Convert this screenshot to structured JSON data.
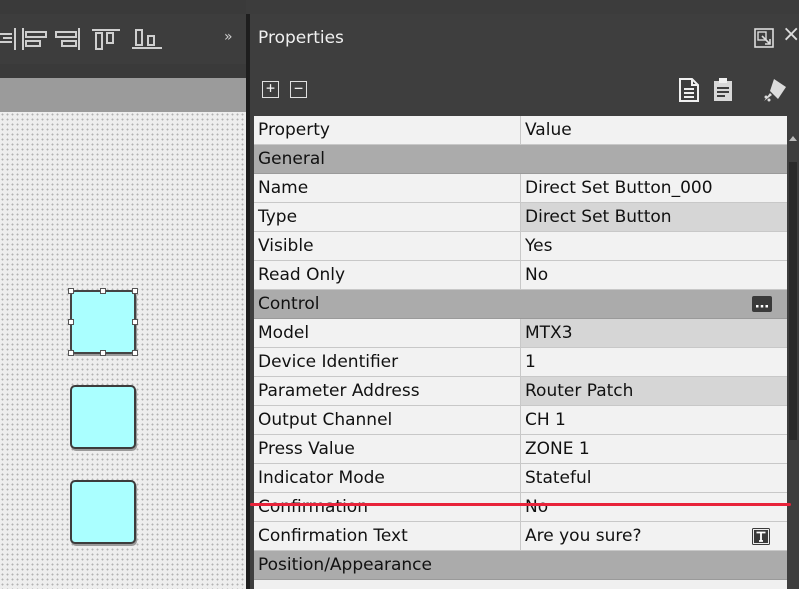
{
  "panel": {
    "title": "Properties",
    "overflow_glyph": "»",
    "close_glyph": "×",
    "expand_glyph": "+",
    "collapse_glyph": "−"
  },
  "grid": {
    "header": {
      "property": "Property",
      "value": "Value"
    },
    "rows": [
      {
        "type": "category",
        "label": "General"
      },
      {
        "type": "prop",
        "key": "Name",
        "value": "Direct Set Button_000",
        "shaded": false
      },
      {
        "type": "prop",
        "key": "Type",
        "value": "Direct Set Button",
        "shaded": true
      },
      {
        "type": "prop",
        "key": "Visible",
        "value": "Yes",
        "shaded": false
      },
      {
        "type": "prop",
        "key": "Read Only",
        "value": "No",
        "shaded": false
      },
      {
        "type": "category",
        "label": "Control",
        "icon": "ellipsis-icon"
      },
      {
        "type": "prop",
        "key": "Model",
        "value": "MTX3",
        "shaded": true
      },
      {
        "type": "prop",
        "key": "Device Identifier",
        "value": "1",
        "shaded": false
      },
      {
        "type": "prop",
        "key": "Parameter Address",
        "value": "Router Patch",
        "shaded": true
      },
      {
        "type": "prop",
        "key": "Output Channel",
        "value": "CH 1",
        "shaded": false
      },
      {
        "type": "prop",
        "key": "Press Value",
        "value": "ZONE 1",
        "shaded": false
      },
      {
        "type": "prop",
        "key": "Indicator Mode",
        "value": "Stateful",
        "shaded": false
      },
      {
        "type": "prop",
        "key": "Confirmation",
        "value": "No",
        "shaded": false
      },
      {
        "type": "prop",
        "key": "Confirmation Text",
        "value": "Are you sure?",
        "shaded": false,
        "icon": "text-edit-icon"
      },
      {
        "type": "category",
        "label": "Position/Appearance"
      }
    ]
  },
  "colors": {
    "highlight_line": "#e8233a",
    "switch_fill": "#aaffff",
    "category_bg": "#ababab"
  }
}
